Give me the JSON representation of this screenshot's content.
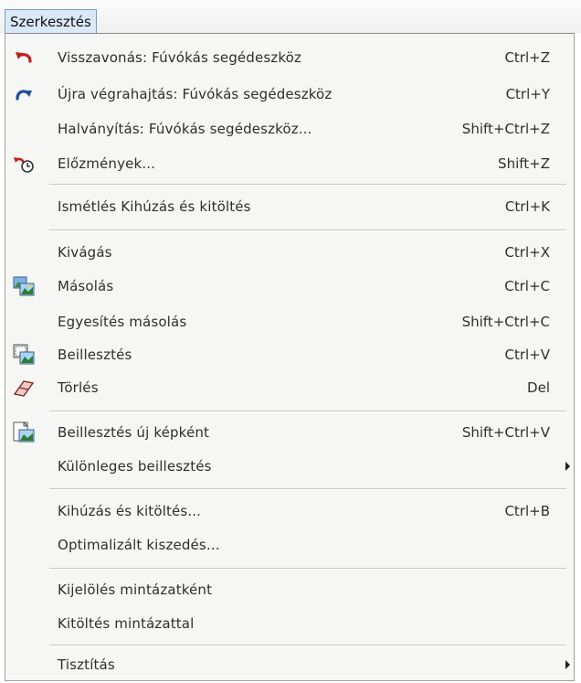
{
  "menu_title": "Szerkesztés",
  "items": [
    {
      "label": "Visszavonás:  Fúvókás segédeszköz",
      "shortcut": "Ctrl+Z",
      "icon": "undo-icon"
    },
    {
      "label": "Újra végrahajtás:  Fúvókás segédeszköz",
      "shortcut": "Ctrl+Y",
      "icon": "redo-icon"
    },
    {
      "label": "Halványítás:  Fúvókás segédeszköz...",
      "shortcut": "Shift+Ctrl+Z"
    },
    {
      "label": "Előzmények...",
      "shortcut": "Shift+Z",
      "icon": "history-icon"
    },
    {
      "label": "Ismétlés Kihúzás és kitöltés",
      "shortcut": "Ctrl+K"
    },
    {
      "label": "Kivágás",
      "shortcut": "Ctrl+X"
    },
    {
      "label": "Másolás",
      "shortcut": "Ctrl+C",
      "icon": "copy-icon"
    },
    {
      "label": "Egyesítés másolás",
      "shortcut": "Shift+Ctrl+C"
    },
    {
      "label": "Beillesztés",
      "shortcut": "Ctrl+V",
      "icon": "paste-icon"
    },
    {
      "label": "Törlés",
      "shortcut": "Del",
      "icon": "eraser-icon"
    },
    {
      "label": "Beillesztés új képként",
      "shortcut": "Shift+Ctrl+V",
      "icon": "paste-as-new-image-icon"
    },
    {
      "label": "Különleges beillesztés",
      "shortcut": "",
      "submenu": true
    },
    {
      "label": "Kihúzás és kitöltés...",
      "shortcut": "Ctrl+B"
    },
    {
      "label": "Optimalizált kiszedés...",
      "shortcut": ""
    },
    {
      "label": "Kijelölés mintázatként",
      "shortcut": ""
    },
    {
      "label": "Kitöltés mintázattal",
      "shortcut": ""
    },
    {
      "label": "Tisztítás",
      "shortcut": "",
      "submenu": true
    }
  ],
  "colors": {
    "menu_background": "#f6f6f5",
    "highlight": "#dbe8f7",
    "undo_red": "#c0201c",
    "redo_blue": "#1d4f9a"
  }
}
